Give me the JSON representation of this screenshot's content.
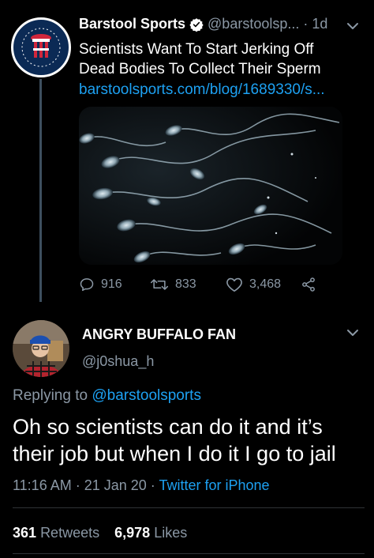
{
  "parent_tweet": {
    "author_name": "Barstool Sports",
    "handle_time": "@barstoolsp... · 1d",
    "text": "Scientists Want To Start Jerking Off Dead Bodies To Collect Their Sperm",
    "link": "barstoolsports.com/blog/1689330/s...",
    "replies": "916",
    "retweets": "833",
    "likes": "3,468"
  },
  "reply_tweet": {
    "author_name": "ANGRY BUFFALO FAN",
    "handle": "@j0shua_h",
    "replying_prefix": "Replying to",
    "replying_to": "@barstoolsports",
    "text": "Oh so scientists can do it and it’s their job but when I do it I go to jail",
    "timestamp": "11:16 AM · 21 Jan 20 · ",
    "source": "Twitter for iPhone",
    "retweet_count": "361",
    "retweet_label": "Retweets",
    "like_count": "6,978",
    "like_label": "Likes"
  },
  "colors": {
    "background": "#000000",
    "link": "#1da1f2",
    "muted": "#8b98a5",
    "avatar_brand": "#0b2a55",
    "logo_red": "#d0263c"
  },
  "icons": [
    "verified-icon",
    "chevron-down-icon",
    "reply-icon",
    "retweet-icon",
    "like-icon",
    "share-icon"
  ]
}
